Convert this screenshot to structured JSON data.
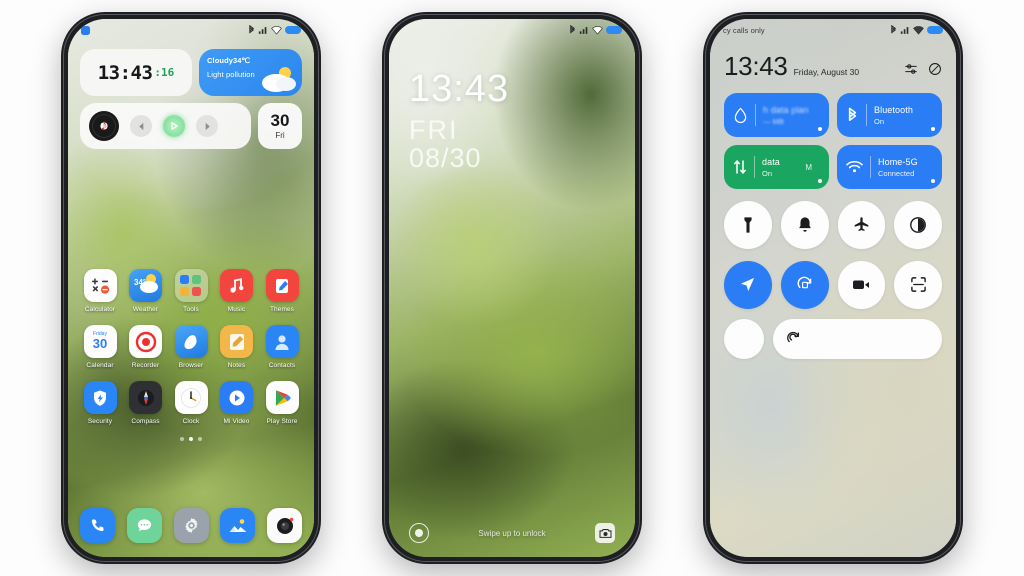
{
  "scene": {
    "background": "#ffffff",
    "phone_count": 3
  },
  "phone1": {
    "name": "home-screen",
    "statusbar": {
      "notification": "notification-badge",
      "icons": [
        "bluetooth-icon",
        "signal-icon",
        "wifi-icon",
        "battery-icon"
      ]
    },
    "clock_widget": {
      "time": "13:43",
      "seconds": ":16",
      "seconds_color": "#23a05a"
    },
    "weather_widget": {
      "line1": "Cloudy34℃",
      "line2": "Light pollution",
      "icon": "sun-behind-cloud-icon",
      "color": "#2b86ee"
    },
    "music_widget": {
      "album_icon": "vinyl-record-icon",
      "prev": "previous-track-icon",
      "play": "play-icon",
      "next": "next-track-icon"
    },
    "calendar_widget": {
      "day": "30",
      "weekday": "Fri"
    },
    "apps_row1": [
      {
        "label": "Calculator",
        "icon": "calculator-icon"
      },
      {
        "label": "Weather",
        "icon": "weather-icon",
        "badge": "34°"
      },
      {
        "label": "Tools",
        "icon": "tools-folder-icon"
      },
      {
        "label": "Music",
        "icon": "music-icon"
      },
      {
        "label": "Themes",
        "icon": "themes-icon"
      }
    ],
    "apps_row2": [
      {
        "label": "Calendar",
        "icon": "calendar-icon",
        "day": "30",
        "weekday": "Friday"
      },
      {
        "label": "Recorder",
        "icon": "recorder-icon"
      },
      {
        "label": "Browser",
        "icon": "browser-icon"
      },
      {
        "label": "Notes",
        "icon": "notes-icon"
      },
      {
        "label": "Contacts",
        "icon": "contacts-icon"
      }
    ],
    "apps_row3": [
      {
        "label": "Security",
        "icon": "security-shield-icon"
      },
      {
        "label": "Compass",
        "icon": "compass-icon"
      },
      {
        "label": "Clock",
        "icon": "clock-icon"
      },
      {
        "label": "Mi Video",
        "icon": "mi-video-icon"
      },
      {
        "label": "Play Store",
        "icon": "play-store-icon"
      }
    ],
    "page_indicator": {
      "total": 3,
      "active": 2
    },
    "dock": [
      {
        "label": "Phone",
        "icon": "phone-icon"
      },
      {
        "label": "Messages",
        "icon": "messages-icon"
      },
      {
        "label": "Settings",
        "icon": "settings-gear-icon"
      },
      {
        "label": "Gallery",
        "icon": "gallery-icon"
      },
      {
        "label": "Camera",
        "icon": "camera-icon"
      }
    ]
  },
  "phone2": {
    "name": "lock-screen",
    "statusbar": {
      "icons": [
        "bluetooth-icon",
        "signal-icon",
        "wifi-icon",
        "battery-icon"
      ]
    },
    "time": "13:43",
    "weekday": "FRI",
    "date": "08/30",
    "hint": "Swipe up to unlock",
    "left_shortcut": "assistant-icon",
    "right_shortcut": "camera-icon"
  },
  "phone3": {
    "name": "control-center",
    "statusbar": {
      "carrier": "cy calls only",
      "icons": [
        "bluetooth-icon",
        "signal-icon",
        "wifi-icon",
        "battery-icon"
      ]
    },
    "time": "13:43",
    "date": "Friday, August 30",
    "header_icons": [
      "settings-sliders-icon",
      "edit-icon"
    ],
    "tiles": [
      {
        "title": "h data plan",
        "subtitle": "— MB",
        "icon": "data-usage-icon",
        "color": "#2b7df5",
        "state": "on",
        "blurred": true
      },
      {
        "title": "Bluetooth",
        "subtitle": "On",
        "icon": "bluetooth-icon",
        "color": "#2b7df5",
        "state": "on",
        "blurred": false
      },
      {
        "title": "data",
        "subtitle": "On",
        "extra": "M",
        "icon": "mobile-data-icon",
        "color": "#1aa560",
        "state": "on",
        "blurred": false
      },
      {
        "title": "Home-5G",
        "subtitle": "Connected",
        "icon": "wifi-icon",
        "color": "#2b7df5",
        "state": "on",
        "blurred": false
      }
    ],
    "toggles_row1": [
      {
        "name": "flashlight-icon",
        "on": false
      },
      {
        "name": "ringer-bell-icon",
        "on": false
      },
      {
        "name": "airplane-mode-icon",
        "on": false
      },
      {
        "name": "dark-mode-icon",
        "on": false
      }
    ],
    "toggles_row2": [
      {
        "name": "location-icon",
        "on": true
      },
      {
        "name": "auto-rotate-icon",
        "on": true
      },
      {
        "name": "screen-recorder-icon",
        "on": false
      },
      {
        "name": "scanner-icon",
        "on": false
      }
    ],
    "bottom_row": {
      "circle": "blank-toggle",
      "pill_icon": "sync-spiral-icon"
    }
  }
}
